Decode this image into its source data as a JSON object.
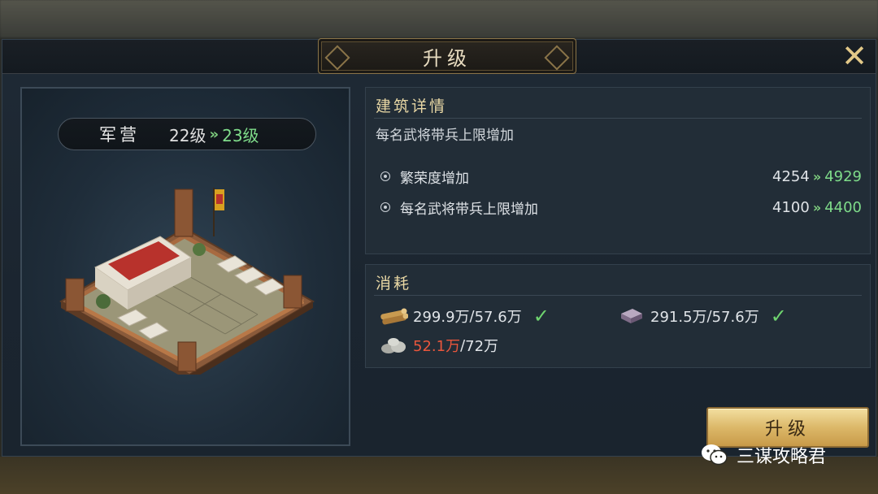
{
  "dialog": {
    "title": "升级",
    "close_icon": "close-icon"
  },
  "building": {
    "name": "军营",
    "current_level": "22级",
    "next_level": "23级",
    "arrow": "»"
  },
  "details": {
    "header": "建筑详情",
    "subtitle": "每名武将带兵上限增加",
    "stats": [
      {
        "label": "繁荣度增加",
        "old": "4254",
        "new": "4929"
      },
      {
        "label": "每名武将带兵上限增加",
        "old": "4100",
        "new": "4400"
      }
    ]
  },
  "cost": {
    "header": "消耗",
    "items": [
      {
        "icon": "wood-icon",
        "have": "299.9万",
        "need": "57.6万",
        "enough": true
      },
      {
        "icon": "iron-icon",
        "have": "291.5万",
        "need": "57.6万",
        "enough": true
      },
      {
        "icon": "stone-icon",
        "have": "52.1万",
        "need": "72万",
        "enough": false
      }
    ]
  },
  "actions": {
    "upgrade_label": "升级"
  },
  "watermark": {
    "text": "三谋攻略君"
  },
  "colors": {
    "gold": "#e8d7a4",
    "green": "#7fdc8a",
    "shortage": "#e8563c"
  }
}
